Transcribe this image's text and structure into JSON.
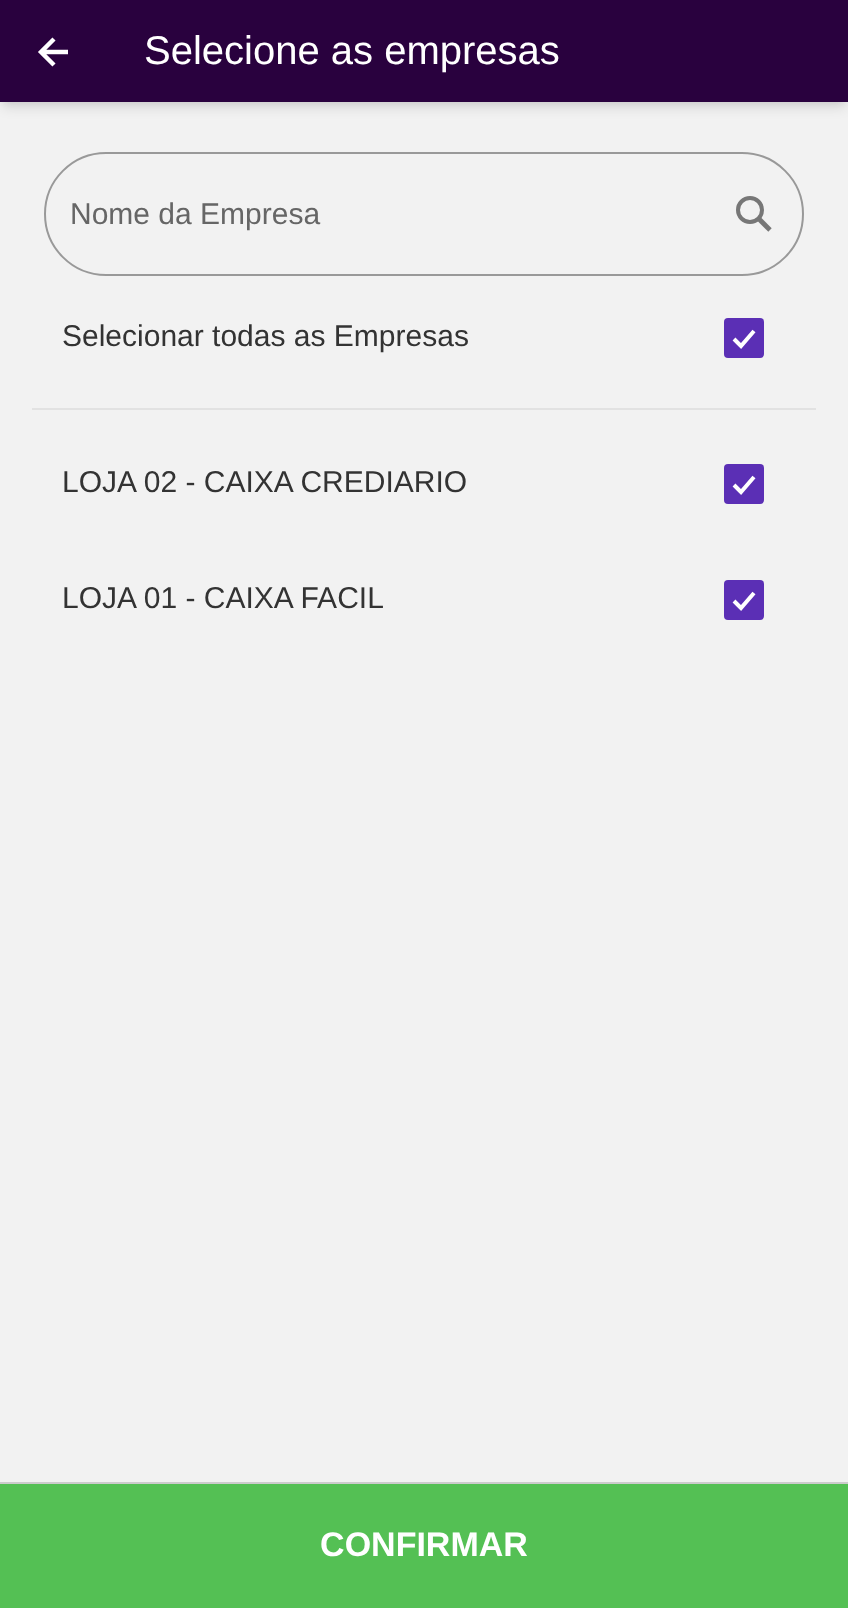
{
  "header": {
    "title": "Selecione as empresas"
  },
  "search": {
    "placeholder": "Nome da Empresa"
  },
  "select_all": {
    "label": "Selecionar todas as Empresas",
    "checked": true
  },
  "companies": [
    {
      "name": "LOJA 02 - CAIXA CREDIARIO",
      "checked": true
    },
    {
      "name": "LOJA 01 - CAIXA FACIL",
      "checked": true
    }
  ],
  "confirm_button": "CONFIRMAR"
}
